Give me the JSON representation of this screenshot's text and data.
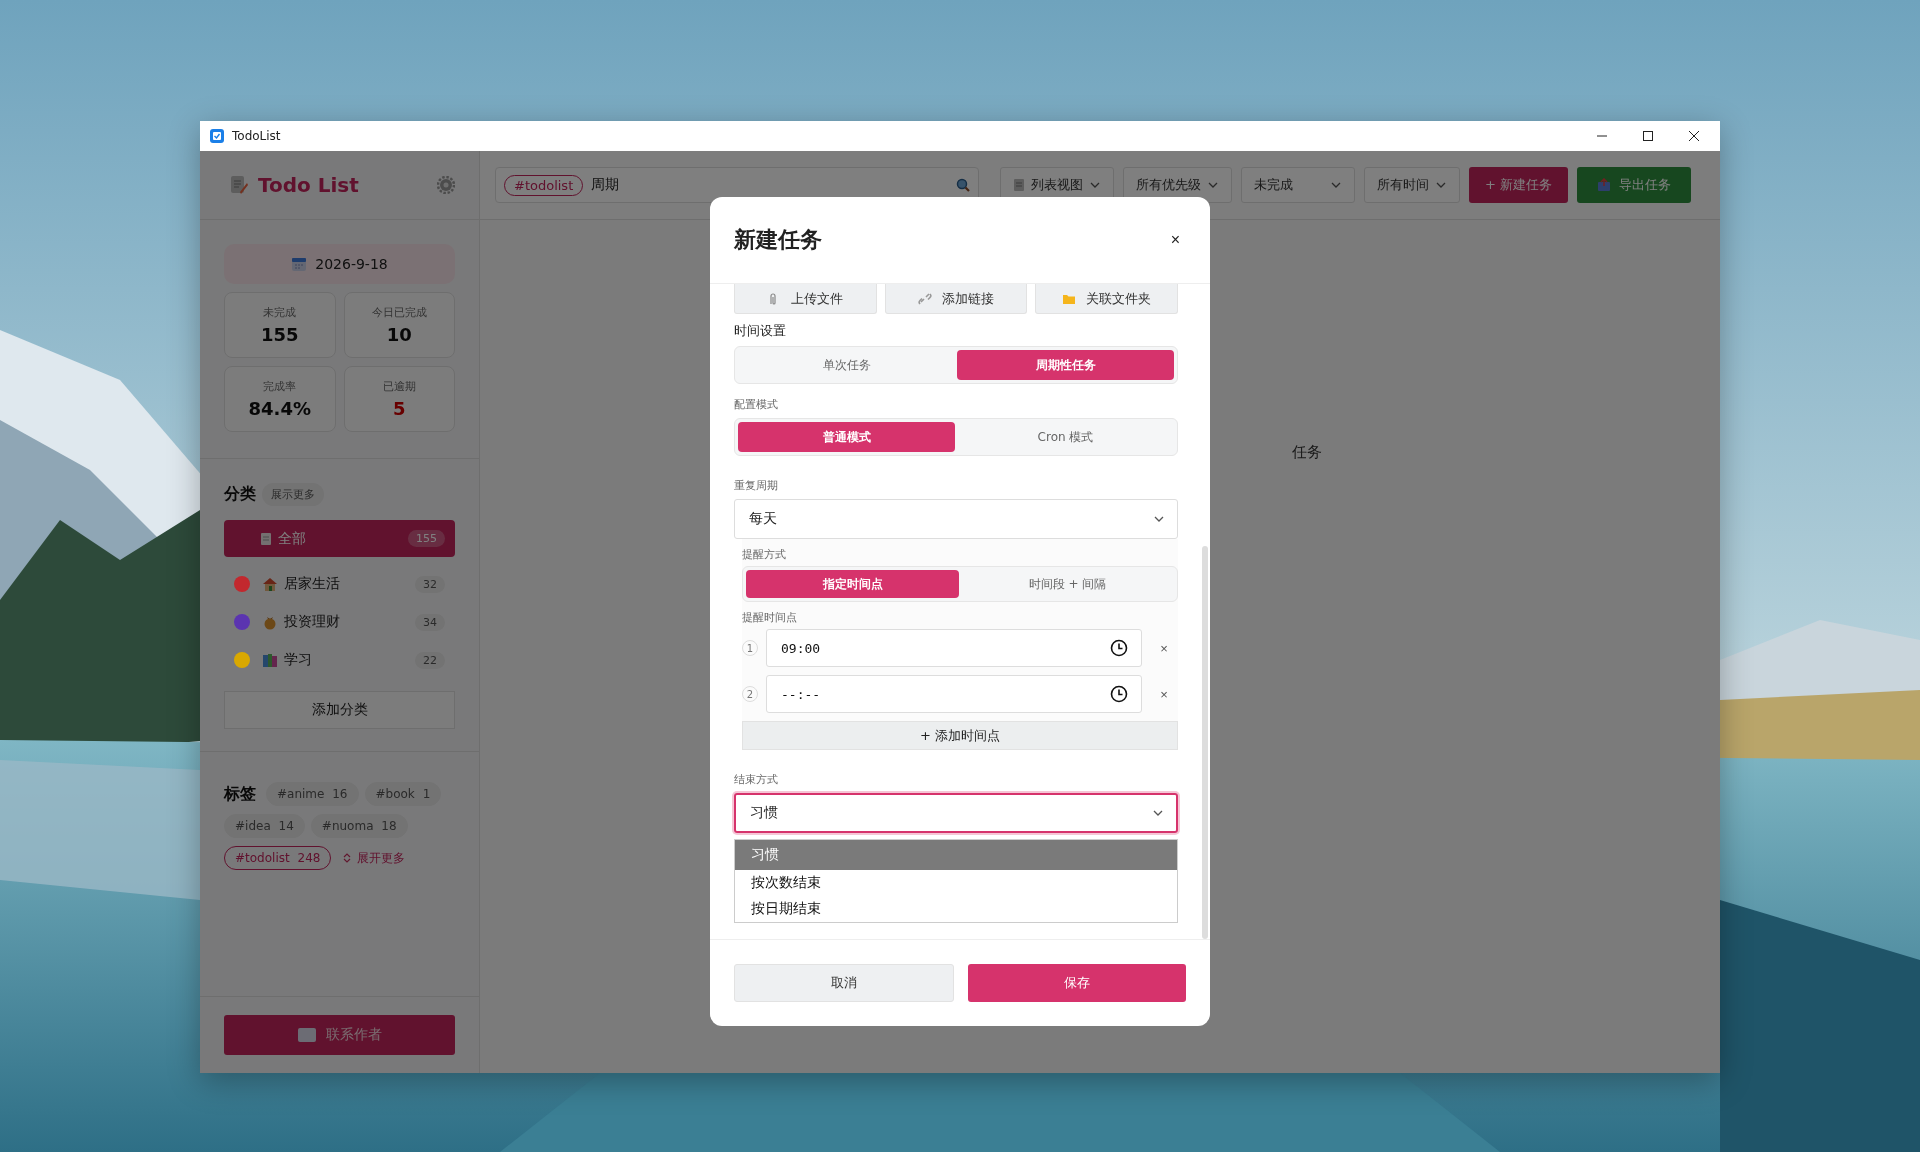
{
  "window": {
    "title": "TodoList"
  },
  "sidebar": {
    "app_title": "Todo List",
    "date": "2026-9-18",
    "stats": [
      {
        "label": "未完成",
        "value": "155",
        "kind": "normal"
      },
      {
        "label": "今日已完成",
        "value": "10",
        "kind": "normal"
      },
      {
        "label": "完成率",
        "value": "84.4%",
        "kind": "normal"
      },
      {
        "label": "已逾期",
        "value": "5",
        "kind": "overdue"
      }
    ],
    "categories": {
      "title": "分类",
      "more": "展示更多",
      "items": [
        {
          "name": "全部",
          "count": "155",
          "selected": true,
          "kind": "all"
        },
        {
          "name": "居家生活",
          "count": "32",
          "selected": false,
          "kind": "category",
          "color": "#c2282e"
        },
        {
          "name": "投资理财",
          "count": "34",
          "selected": false,
          "kind": "category",
          "color": "#5b34b0"
        },
        {
          "name": "学习",
          "count": "22",
          "selected": false,
          "kind": "category",
          "color": "#d9a800"
        }
      ],
      "add_button": "添加分类"
    },
    "tags": {
      "title": "标签",
      "items": [
        {
          "name": "#anime",
          "count": "16",
          "selected": false
        },
        {
          "name": "#book",
          "count": "1",
          "selected": false
        },
        {
          "name": "#idea",
          "count": "14",
          "selected": false
        },
        {
          "name": "#nuoma",
          "count": "18",
          "selected": false
        },
        {
          "name": "#todolist",
          "count": "248",
          "selected": true
        }
      ],
      "expand": "展开更多"
    },
    "contact_button": "联系作者"
  },
  "toolbar": {
    "search_tag": "#todolist",
    "search_value": "周期",
    "filters": [
      "列表视图",
      "所有优先级",
      "未完成",
      "所有时间"
    ],
    "new_button": "+ 新建任务",
    "export_button": "导出任务"
  },
  "main": {
    "background_text": "任务"
  },
  "dialog": {
    "title": "新建任务",
    "close": "×",
    "attachments": [
      "上传文件",
      "添加链接",
      "关联文件夹"
    ],
    "time_settings": {
      "label": "时间设置",
      "options": [
        {
          "label": "单次任务",
          "selected": false
        },
        {
          "label": "周期性任务",
          "selected": true
        }
      ]
    },
    "config_mode": {
      "label": "配置模式",
      "options": [
        {
          "label": "普通模式",
          "selected": true
        },
        {
          "label": "Cron 模式",
          "selected": false
        }
      ]
    },
    "repeat": {
      "label": "重复周期",
      "value": "每天"
    },
    "reminder": {
      "label": "提醒方式",
      "options": [
        {
          "label": "指定时间点",
          "selected": true
        },
        {
          "label": "时间段 + 间隔",
          "selected": false
        }
      ],
      "times_label": "提醒时间点",
      "times": [
        {
          "index": "1",
          "value": "09:00"
        },
        {
          "index": "2",
          "placeholder": "--:--"
        }
      ],
      "remove": "×",
      "add_button": "+ 添加时间点"
    },
    "end": {
      "label": "结束方式",
      "value": "习惯",
      "options": [
        {
          "label": "习惯",
          "selected": true
        },
        {
          "label": "按次数结束",
          "selected": false
        },
        {
          "label": "按日期结束",
          "selected": false
        }
      ]
    },
    "cancel": "取消",
    "save": "保存"
  }
}
